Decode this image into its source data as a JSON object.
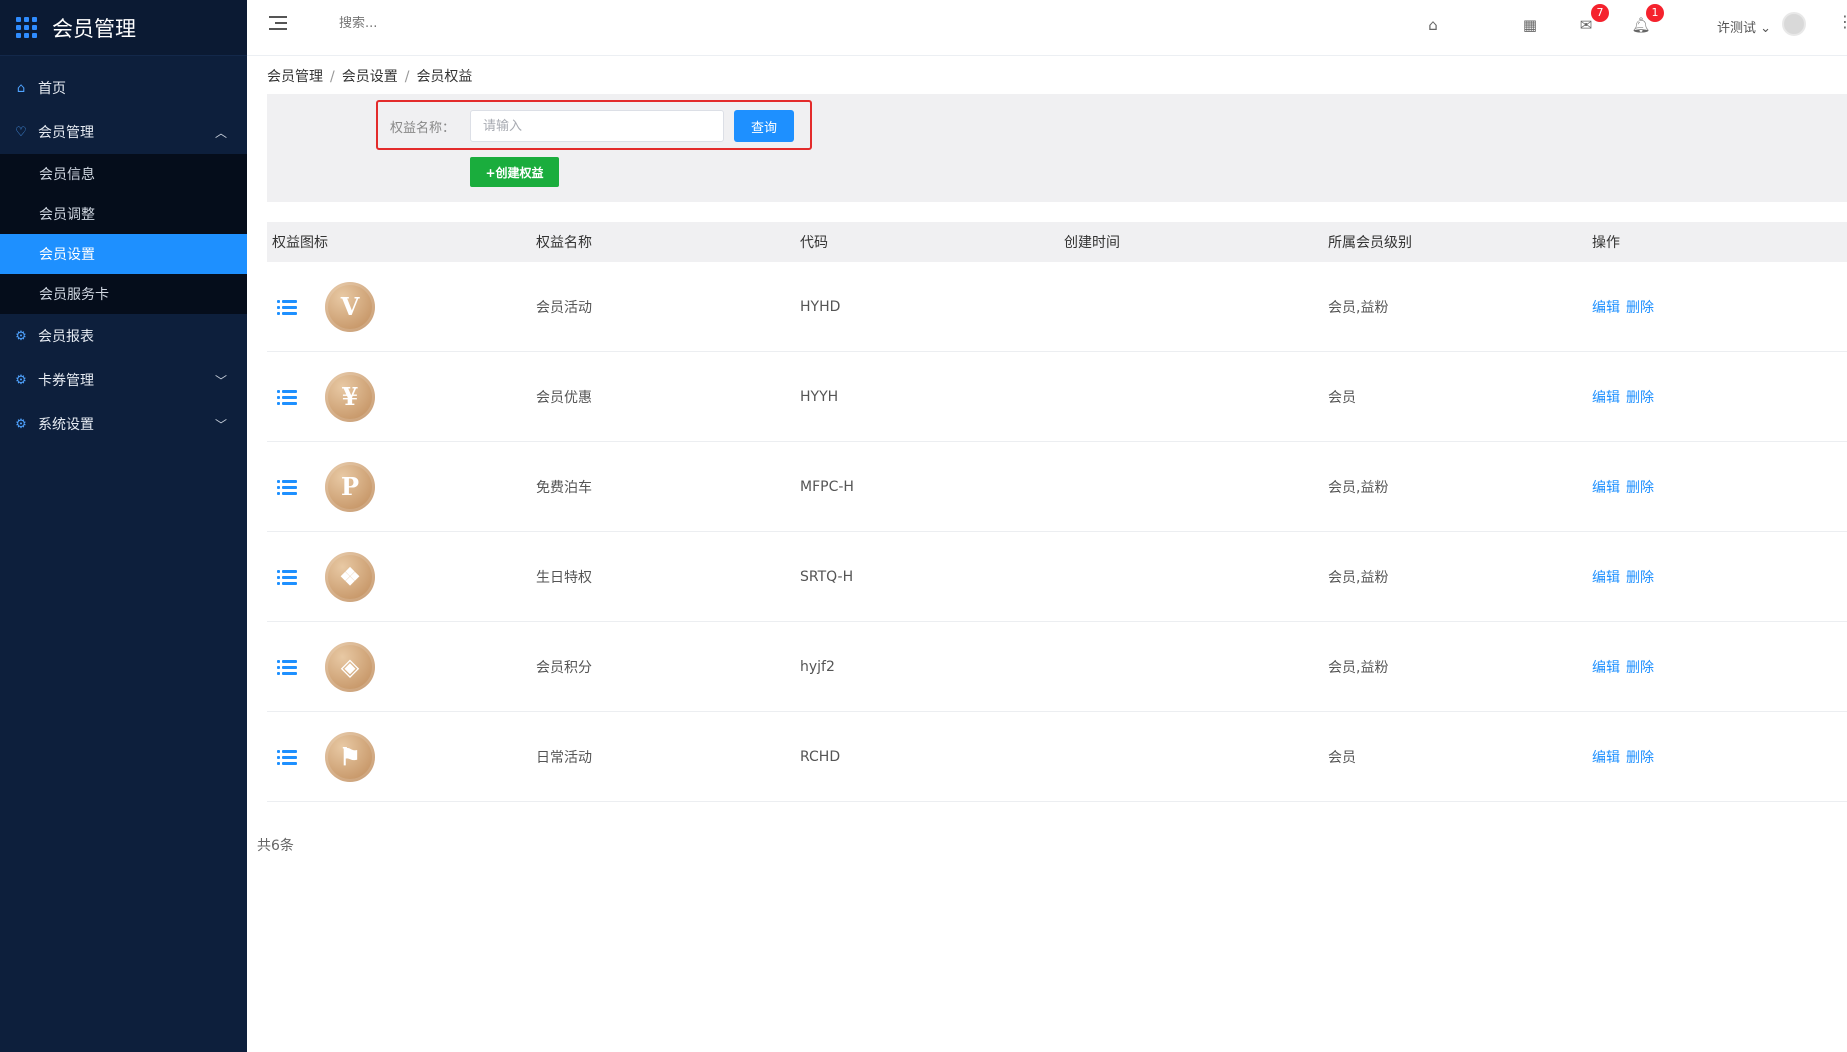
{
  "app": {
    "title": "会员管理"
  },
  "sidebar": {
    "items": [
      {
        "label": "首页",
        "icon": "home-icon"
      },
      {
        "label": "会员管理",
        "icon": "member-icon",
        "expanded": true,
        "children": [
          {
            "label": "会员信息"
          },
          {
            "label": "会员调整"
          },
          {
            "label": "会员设置",
            "active": true
          },
          {
            "label": "会员服务卡"
          }
        ]
      },
      {
        "label": "会员报表",
        "icon": "report-gear-icon"
      },
      {
        "label": "卡券管理",
        "icon": "coupon-gear-icon",
        "expanded": false
      },
      {
        "label": "系统设置",
        "icon": "settings-gear-icon",
        "expanded": false
      }
    ]
  },
  "header": {
    "search_placeholder": "搜索...",
    "mail_badge": "7",
    "bell_badge": "1",
    "user_name": "许测试"
  },
  "breadcrumb": [
    "会员管理",
    "会员设置",
    "会员权益"
  ],
  "filter": {
    "label": "权益名称：",
    "input_placeholder": "请输入",
    "query_label": "查询",
    "create_label": "+创建权益"
  },
  "table": {
    "headers": [
      "权益图标",
      "权益名称",
      "代码",
      "创建时间",
      "所属会员级别",
      "操作"
    ],
    "rows": [
      {
        "icon": "v-medal-icon",
        "glyph": "V",
        "name": "会员活动",
        "code": "HYHD",
        "created": "",
        "levels": "会员,益粉"
      },
      {
        "icon": "coupon-yen-medal-icon",
        "glyph": "¥",
        "name": "会员优惠",
        "code": "HYYH",
        "created": "",
        "levels": "会员"
      },
      {
        "icon": "parking-medal-icon",
        "glyph": "P",
        "name": "免费泊车",
        "code": "MFPC-H",
        "created": "",
        "levels": "会员,益粉"
      },
      {
        "icon": "gift-medal-icon",
        "glyph": "❖",
        "name": "生日特权",
        "code": "SRTQ-H",
        "created": "",
        "levels": "会员,益粉"
      },
      {
        "icon": "points-medal-icon",
        "glyph": "◈",
        "name": "会员积分",
        "code": "hyjf2",
        "created": "",
        "levels": "会员,益粉"
      },
      {
        "icon": "flag-medal-icon",
        "glyph": "⚑",
        "name": "日常活动",
        "code": "RCHD",
        "created": "",
        "levels": "会员"
      }
    ],
    "edit_label": "编辑",
    "delete_label": "删除"
  },
  "pagination": {
    "total_text": "共6条"
  },
  "colors": {
    "sidebar_bg": "#0d1f3c",
    "primary": "#1e90ff",
    "create_green": "#1aad3d",
    "highlight_red": "#e32b2b"
  }
}
